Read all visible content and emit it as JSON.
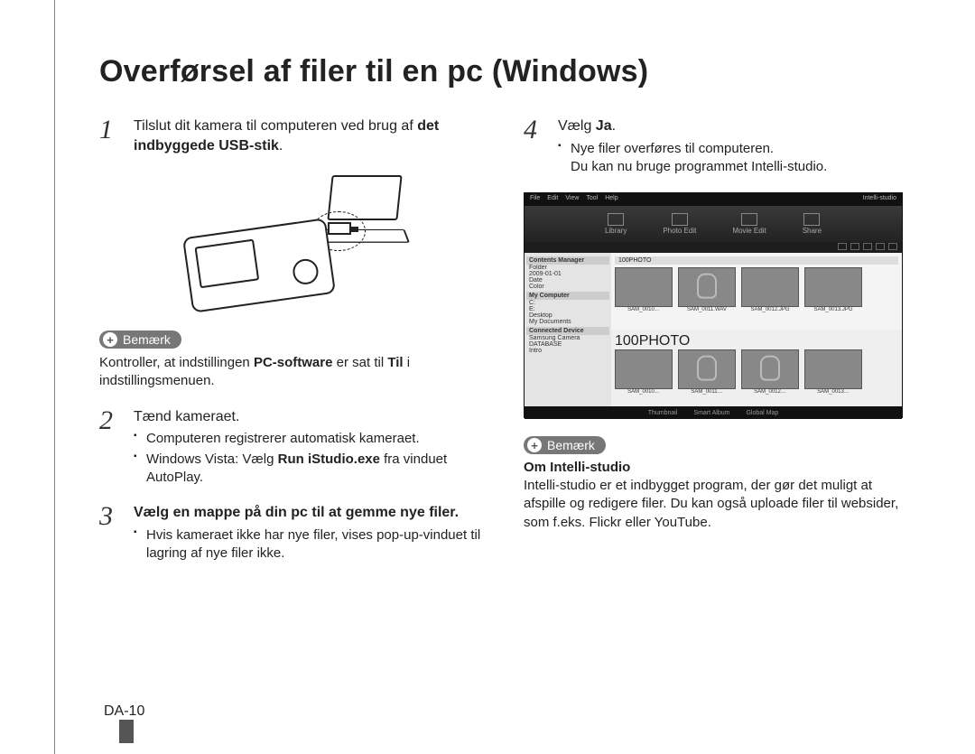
{
  "title": "Overførsel af filer til en pc (Windows)",
  "pageNumber": "DA-10",
  "left": {
    "step1": {
      "num": "1",
      "text_before": "Tilslut dit kamera til computeren ved brug af ",
      "text_bold": "det indbyggede USB-stik",
      "text_after": "."
    },
    "note1": {
      "label": "Bemærk",
      "text_before": "Kontroller, at indstillingen ",
      "text_bold1": "PC-software",
      "text_mid": " er sat til ",
      "text_bold2": "Til",
      "text_after": " i indstillingsmenuen."
    },
    "step2": {
      "num": "2",
      "lead": "Tænd kameraet.",
      "b1": "Computeren registrerer automatisk kameraet.",
      "b2_before": "Windows Vista: Vælg ",
      "b2_bold": "Run iStudio.exe",
      "b2_after": " fra vinduet AutoPlay."
    },
    "step3": {
      "num": "3",
      "lead": "Vælg en mappe på din pc til at gemme nye filer.",
      "b1": "Hvis kameraet ikke har nye filer, vises pop-up-vinduet til lagring af nye filer ikke."
    }
  },
  "right": {
    "step4": {
      "num": "4",
      "lead_before": "Vælg ",
      "lead_bold": "Ja",
      "lead_after": ".",
      "b1": "Nye filer overføres til computeren.",
      "b1_line2": "Du kan nu bruge programmet Intelli-studio."
    },
    "screenshot": {
      "appTitle": "Intelli-studio",
      "menus": [
        "File",
        "Edit",
        "View",
        "Tool",
        "Help"
      ],
      "toolbar": [
        "Library",
        "Photo Edit",
        "Movie Edit",
        "Share"
      ],
      "side": {
        "hdr1": "Contents Manager",
        "items1": [
          "Folder",
          "2009-01-01",
          "Date",
          "Color"
        ],
        "hdr2": "My Computer",
        "items2": [
          "C:",
          "E:",
          "Desktop",
          "My Documents"
        ],
        "hdr3": "Connected Device",
        "items3": [
          "Samsung Camera",
          "DATABASE",
          "Intro"
        ]
      },
      "pane1": {
        "header": "100PHOTO",
        "thumbs": [
          "SAM_0010…",
          "SAM_0011.WAV",
          "SAM_0012.JPG",
          "SAM_0013.JPG"
        ]
      },
      "pane2": {
        "header": "100PHOTO",
        "thumbs": [
          "SAM_0010…",
          "SAM_0011…",
          "SAM_0012…",
          "SAM_0013…"
        ]
      },
      "footer": [
        "Thumbnail",
        "Smart Album",
        "Global Map"
      ]
    },
    "note2": {
      "label": "Bemærk",
      "subtitle": "Om Intelli-studio",
      "text": "Intelli-studio er et indbygget program, der gør det muligt at afspille og redigere filer. Du kan også uploade filer til websider, som f.eks. Flickr eller YouTube."
    }
  }
}
